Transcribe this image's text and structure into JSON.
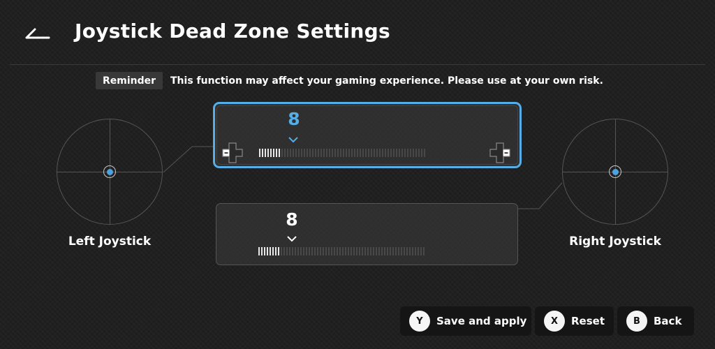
{
  "header": {
    "title": "Joystick Dead Zone Settings",
    "back_icon": "back-arrow-icon"
  },
  "reminder": {
    "badge": "Reminder",
    "text": "This function may affect your gaming experience. Please use at your own risk."
  },
  "left_joystick": {
    "label": "Left Joystick",
    "dead_zone_value": "8",
    "ticks_total": 60,
    "ticks_filled": 8
  },
  "right_joystick": {
    "label": "Right Joystick",
    "dead_zone_value": "8",
    "ticks_total": 60,
    "ticks_filled": 8
  },
  "slider_controls": {
    "minus_label": "-",
    "plus_label": "-"
  },
  "footer": {
    "save": {
      "key": "Y",
      "label": "Save and apply"
    },
    "reset": {
      "key": "X",
      "label": "Reset"
    },
    "back": {
      "key": "B",
      "label": "Back"
    }
  },
  "colors": {
    "accent": "#56aee8",
    "background": "#202020",
    "button_bg": "#151515"
  }
}
